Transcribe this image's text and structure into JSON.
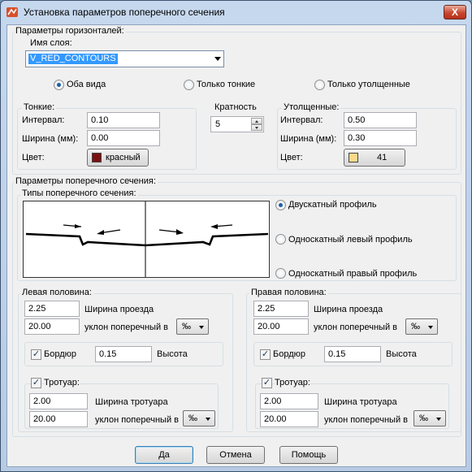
{
  "window": {
    "title": "Установка параметров поперечного сечения",
    "close_label": "X"
  },
  "contour": {
    "group_label": "Параметры горизонталей:",
    "layer_label": "Имя слоя:",
    "layer_value": "V_RED_CONTOURS",
    "radio_both": "Оба вида",
    "radio_thin": "Только тонкие",
    "radio_thick": "Только утолщенные",
    "thin": {
      "label": "Тонкие:",
      "interval_label": "Интервал:",
      "interval_value": "0.10",
      "width_label": "Ширина (мм):",
      "width_value": "0.00",
      "color_label": "Цвет:",
      "color_button": "красный",
      "color_swatch": "#7b1010"
    },
    "multiplicity": {
      "label": "Кратность",
      "value": "5"
    },
    "thick": {
      "label": "Утолщенные:",
      "interval_label": "Интервал:",
      "interval_value": "0.50",
      "width_label": "Ширина (мм):",
      "width_value": "0.30",
      "color_label": "Цвет:",
      "color_button": "41",
      "color_swatch": "#ffd98a"
    }
  },
  "section": {
    "group_label": "Параметры поперечного сечения:",
    "types_label": "Типы поперечного сечения:",
    "type_gable": "Двускатный профиль",
    "type_left": "Односкатный левый профиль",
    "type_right": "Односкатный правый профиль",
    "left": {
      "label": "Левая половина:",
      "road_width_value": "2.25",
      "road_width_label": "Ширина проезда",
      "slope_value": "20.00",
      "slope_label": "уклон поперечный в",
      "slope_unit": "‰",
      "curb_label": "Бордюр",
      "curb_value": "0.15",
      "height_label": "Высота",
      "sidewalk_label": "Тротуар:",
      "sidewalk_width_value": "2.00",
      "sidewalk_width_label": "Ширина тротуара",
      "sidewalk_slope_value": "20.00",
      "sidewalk_slope_label": "уклон поперечный в",
      "sidewalk_slope_unit": "‰"
    },
    "right": {
      "label": "Правая половина:",
      "road_width_value": "2.25",
      "road_width_label": "Ширина проезда",
      "slope_value": "20.00",
      "slope_label": "уклон поперечный в",
      "slope_unit": "‰",
      "curb_label": "Бордюр",
      "curb_value": "0.15",
      "height_label": "Высота",
      "sidewalk_label": "Тротуар:",
      "sidewalk_width_value": "2.00",
      "sidewalk_width_label": "Ширина тротуара",
      "sidewalk_slope_value": "20.00",
      "sidewalk_slope_label": "уклон поперечный в",
      "sidewalk_slope_unit": "‰"
    }
  },
  "buttons": {
    "ok": "Да",
    "cancel": "Отмена",
    "help": "Помощь"
  }
}
